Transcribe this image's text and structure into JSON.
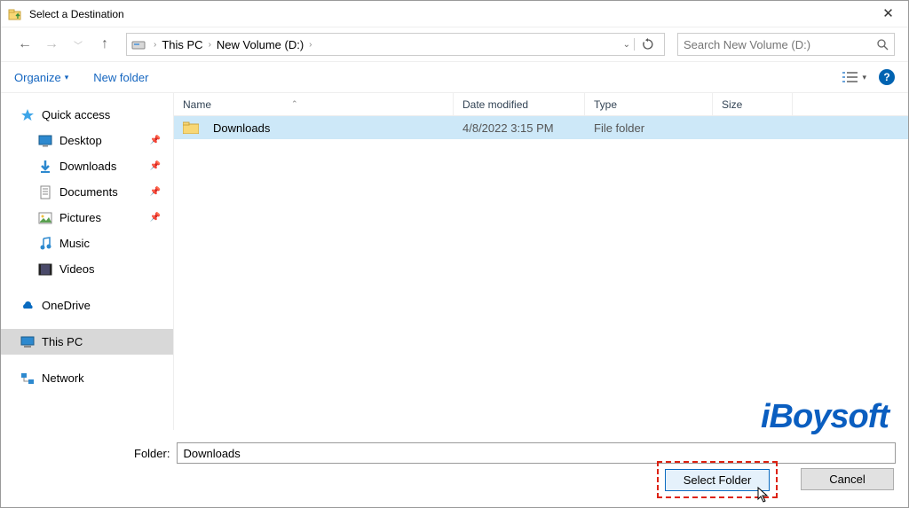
{
  "titlebar": {
    "title": "Select a Destination"
  },
  "breadcrumb": {
    "items": [
      "This PC",
      "New Volume (D:)"
    ]
  },
  "search": {
    "placeholder": "Search New Volume (D:)"
  },
  "toolbar": {
    "organize": "Organize",
    "newfolder": "New folder"
  },
  "sidebar": {
    "quickaccess": "Quick access",
    "desktop": "Desktop",
    "downloads": "Downloads",
    "documents": "Documents",
    "pictures": "Pictures",
    "music": "Music",
    "videos": "Videos",
    "onedrive": "OneDrive",
    "thispc": "This PC",
    "network": "Network"
  },
  "columns": {
    "name": "Name",
    "date": "Date modified",
    "type": "Type",
    "size": "Size"
  },
  "rows": [
    {
      "name": "Downloads",
      "date": "4/8/2022 3:15 PM",
      "type": "File folder",
      "size": ""
    }
  ],
  "footer": {
    "folder_label": "Folder:",
    "folder_value": "Downloads",
    "select": "Select Folder",
    "cancel": "Cancel"
  },
  "watermark": "iBoysoft"
}
